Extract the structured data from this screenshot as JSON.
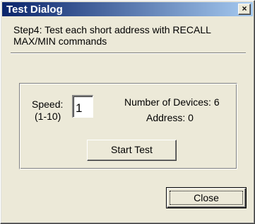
{
  "window": {
    "title": "Test Dialog",
    "close_glyph": "×"
  },
  "instruction": "Step4: Test each short address with RECALL MAX/MIN commands",
  "speed": {
    "label": "Speed:",
    "range": "(1-10)",
    "value": "1"
  },
  "status": {
    "num_devices": "Number of Devices: 6",
    "address": "Address: 0"
  },
  "buttons": {
    "start_test": "Start Test",
    "close": "Close"
  },
  "colors": {
    "face": "#ece9d8",
    "title_gradient_start": "#0a246a",
    "title_gradient_end": "#a6caf0"
  },
  "icons": {
    "title_close": "close-icon"
  }
}
